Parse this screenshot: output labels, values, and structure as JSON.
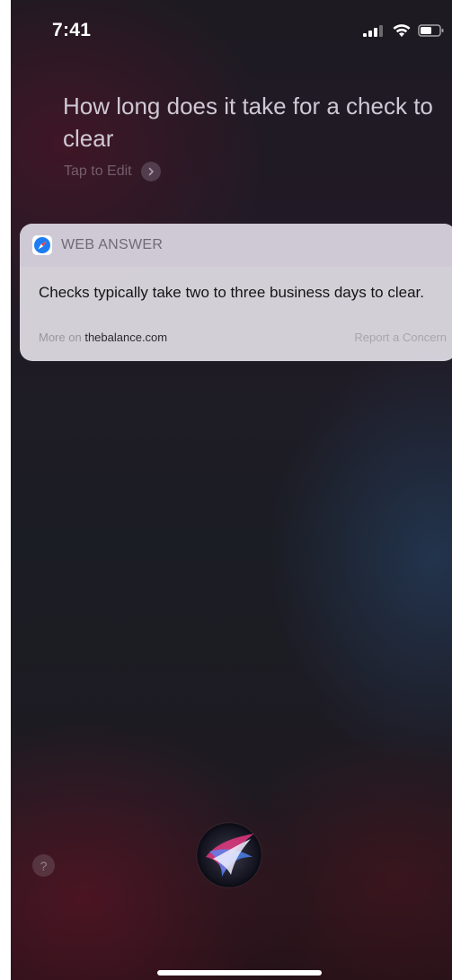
{
  "status_bar": {
    "time": "7:41",
    "icons": [
      "signal-icon",
      "wifi-icon",
      "battery-icon"
    ]
  },
  "siri": {
    "query": "How long does it take for a check to clear",
    "tap_to_edit": "Tap to Edit"
  },
  "answer_card": {
    "header_label": "WEB ANSWER",
    "header_icon": "safari-icon",
    "answer": "Checks typically take two to three business days to clear.",
    "more_on_prefix": "More on",
    "source": "thebalance.com",
    "report": "Report a Concern"
  },
  "bottom": {
    "help_label": "?"
  },
  "colors": {
    "card_background": "#ECE8F0",
    "card_header": "#CDC8D4",
    "safari_blue": "#1E7CF2"
  }
}
